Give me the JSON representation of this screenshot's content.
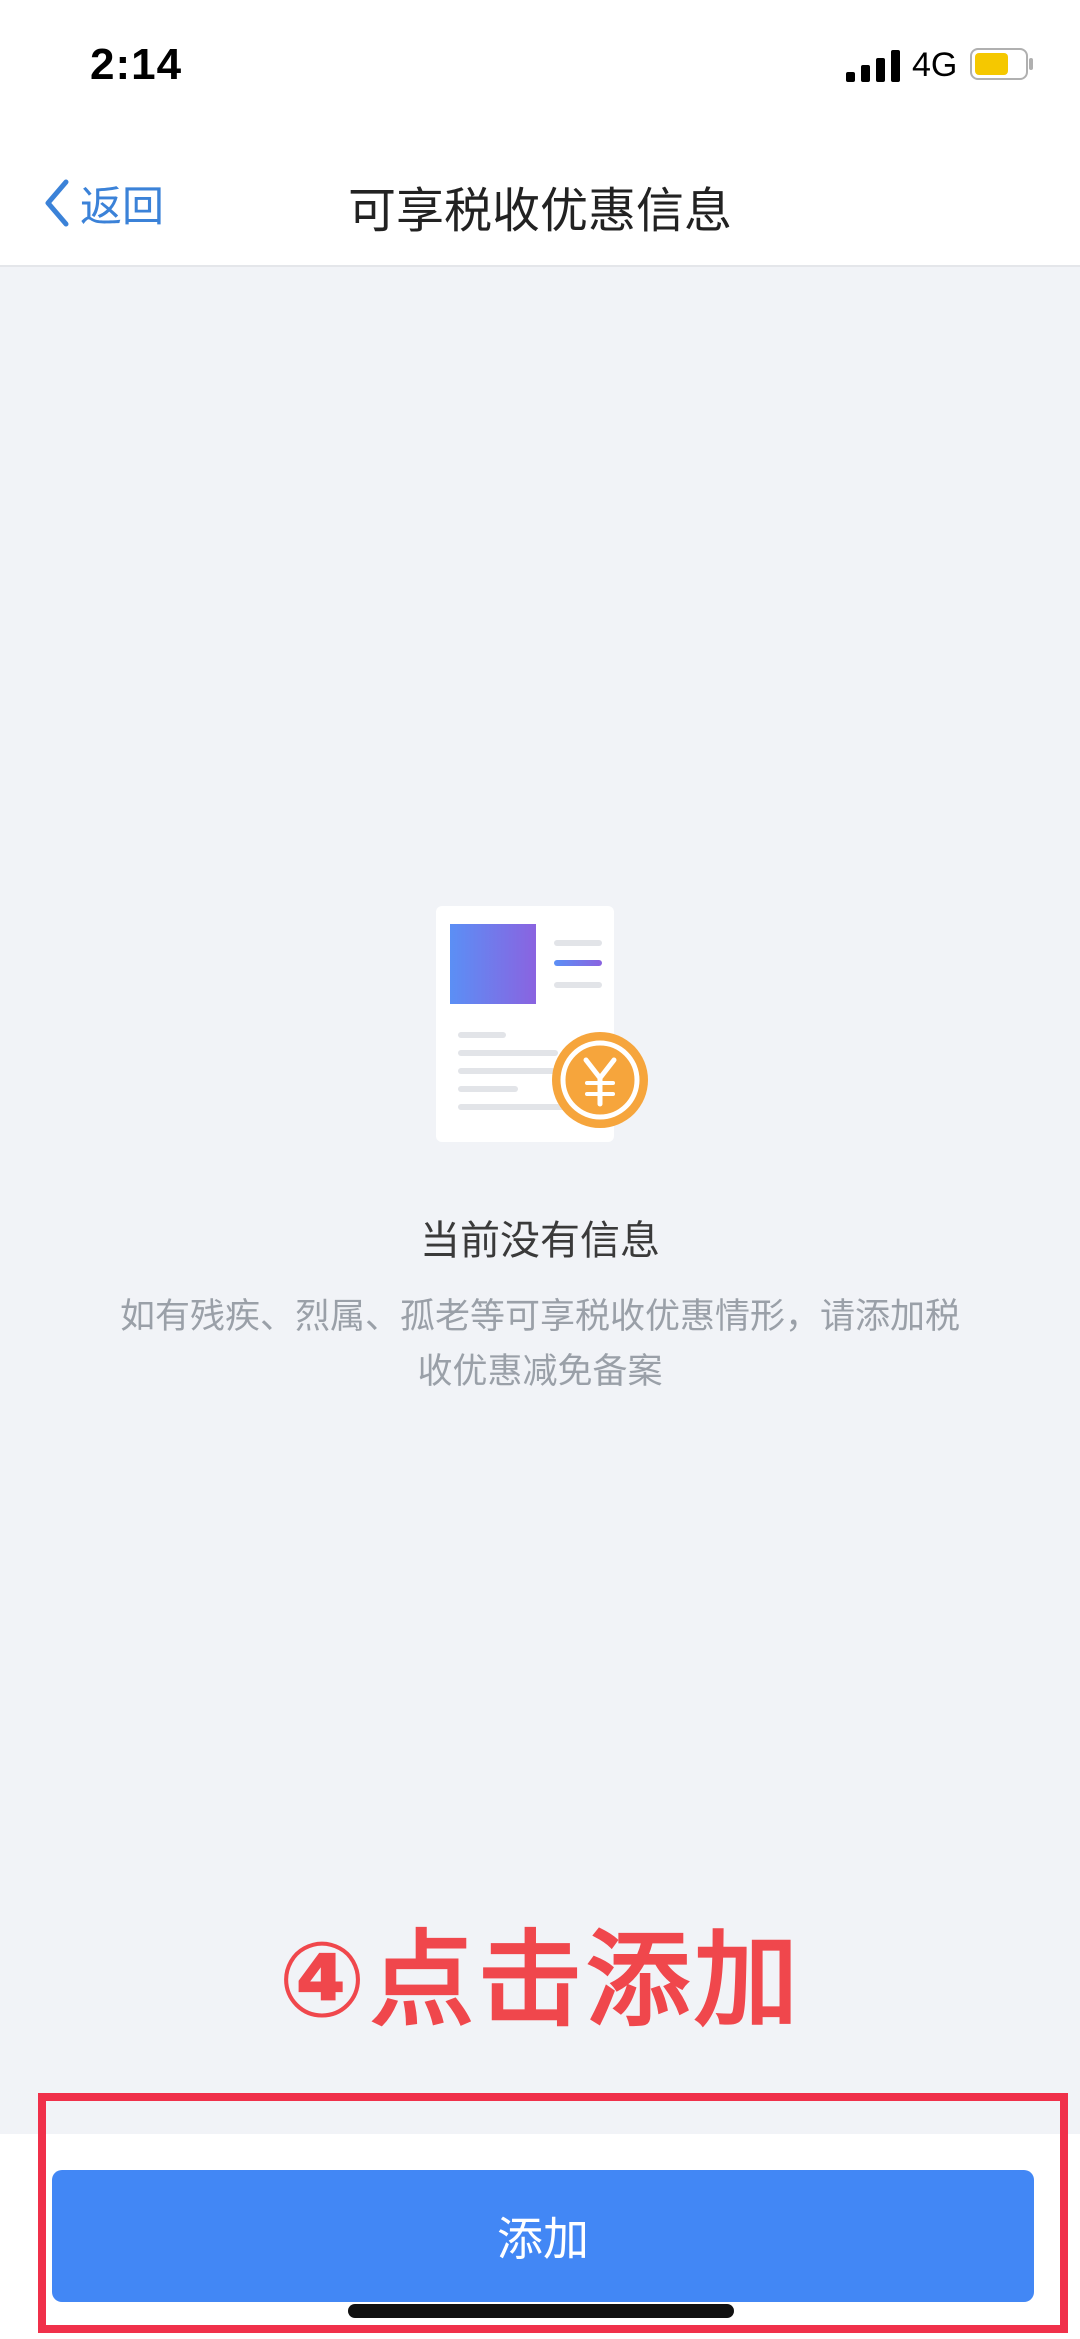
{
  "status_bar": {
    "time": "2:14",
    "network": "4G",
    "signal_icon": "cellular-signal-icon",
    "battery_icon": "battery-icon",
    "battery_color": "#f5c800"
  },
  "nav": {
    "back_label": "返回",
    "back_icon": "chevron-left-icon",
    "title": "可享税收优惠信息",
    "accent_color": "#3b82d8"
  },
  "empty_state": {
    "illustration_icon": "document-yuan-icon",
    "title": "当前没有信息",
    "description": "如有残疾、烈属、孤老等可享税收优惠情形，请添加税收优惠减免备案"
  },
  "annotation": {
    "text": "④点击添加",
    "color": "#f0474c"
  },
  "footer": {
    "add_label": "添加",
    "button_color": "#4287f5"
  }
}
